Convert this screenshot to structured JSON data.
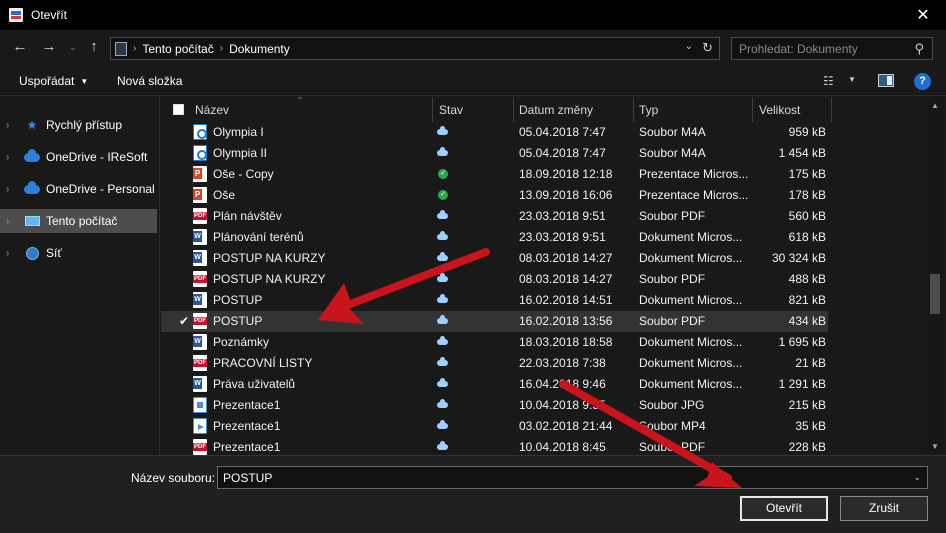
{
  "window": {
    "title": "Otevřít",
    "close": "✕"
  },
  "address": {
    "crumbs": [
      "Tento počítač",
      "Dokumenty"
    ],
    "search_placeholder": "Prohledat: Dokumenty"
  },
  "toolbar": {
    "organize": "Uspořádat",
    "new_folder": "Nová složka"
  },
  "sidebar": {
    "items": [
      {
        "label": "Rychlý přístup",
        "icon": "star-icon"
      },
      {
        "label": "OneDrive - IReSoft",
        "icon": "cloud-icon"
      },
      {
        "label": "OneDrive - Personal",
        "icon": "cloud-icon"
      },
      {
        "label": "Tento počítač",
        "icon": "computer-icon",
        "selected": true
      },
      {
        "label": "Síť",
        "icon": "network-icon"
      }
    ]
  },
  "columns": {
    "name": "Název",
    "status": "Stav",
    "date": "Datum změny",
    "type": "Typ",
    "size": "Velikost"
  },
  "files": [
    {
      "name": "Olympia I",
      "kind": "m4a",
      "status": "cloud",
      "date": "05.04.2018 7:47",
      "type": "Soubor M4A",
      "size": "959 kB"
    },
    {
      "name": "Olympia II",
      "kind": "m4a",
      "status": "cloud",
      "date": "05.04.2018 7:47",
      "type": "Soubor M4A",
      "size": "1 454 kB"
    },
    {
      "name": "Oše - Copy",
      "kind": "ppt",
      "status": "ok",
      "date": "18.09.2018 12:18",
      "type": "Prezentace Micros...",
      "size": "175 kB"
    },
    {
      "name": "Oše",
      "kind": "ppt",
      "status": "ok",
      "date": "13.09.2018 16:06",
      "type": "Prezentace Micros...",
      "size": "178 kB"
    },
    {
      "name": "Plán návštěv",
      "kind": "pdf",
      "status": "cloud",
      "date": "23.03.2018 9:51",
      "type": "Soubor PDF",
      "size": "560 kB"
    },
    {
      "name": "Plánování terénů",
      "kind": "doc",
      "status": "cloud",
      "date": "23.03.2018 9:51",
      "type": "Dokument Micros...",
      "size": "618 kB"
    },
    {
      "name": "POSTUP NA KURZY",
      "kind": "doc",
      "status": "cloud",
      "date": "08.03.2018 14:27",
      "type": "Dokument Micros...",
      "size": "30 324 kB"
    },
    {
      "name": "POSTUP NA KURZY",
      "kind": "pdf",
      "status": "cloud",
      "date": "08.03.2018 14:27",
      "type": "Soubor PDF",
      "size": "488 kB"
    },
    {
      "name": "POSTUP",
      "kind": "doc",
      "status": "cloud",
      "date": "16.02.2018 14:51",
      "type": "Dokument Micros...",
      "size": "821 kB"
    },
    {
      "name": "POSTUP",
      "kind": "pdf",
      "status": "cloud",
      "date": "16.02.2018 13:56",
      "type": "Soubor PDF",
      "size": "434 kB",
      "selected": true
    },
    {
      "name": "Poznámky",
      "kind": "doc",
      "status": "cloud",
      "date": "18.03.2018 18:58",
      "type": "Dokument Micros...",
      "size": "1 695 kB"
    },
    {
      "name": "PRACOVNÍ LISTY",
      "kind": "pdf",
      "status": "cloud",
      "date": "22.03.2018 7:38",
      "type": "Dokument Micros...",
      "size": "21 kB"
    },
    {
      "name": "Práva uživatelů",
      "kind": "doc",
      "status": "cloud",
      "date": "16.04.2018 9:46",
      "type": "Dokument Micros...",
      "size": "1 291 kB"
    },
    {
      "name": "Prezentace1",
      "kind": "jpg",
      "status": "cloud",
      "date": "10.04.2018 9:55",
      "type": "Soubor JPG",
      "size": "215 kB"
    },
    {
      "name": "Prezentace1",
      "kind": "mp4",
      "status": "cloud",
      "date": "03.02.2018 21:44",
      "type": "Soubor MP4",
      "size": "35 kB"
    },
    {
      "name": "Prezentace1",
      "kind": "pdf",
      "status": "cloud",
      "date": "10.04.2018 8:45",
      "type": "Soubor PDF",
      "size": "228 kB"
    }
  ],
  "footer": {
    "filename_label": "Název souboru:",
    "filename_value": "POSTUP",
    "open_button": "Otevřít",
    "cancel_button": "Zrušit"
  },
  "colors": {
    "annotation_arrow": "#c8141a",
    "accent": "#1f6fd1"
  }
}
